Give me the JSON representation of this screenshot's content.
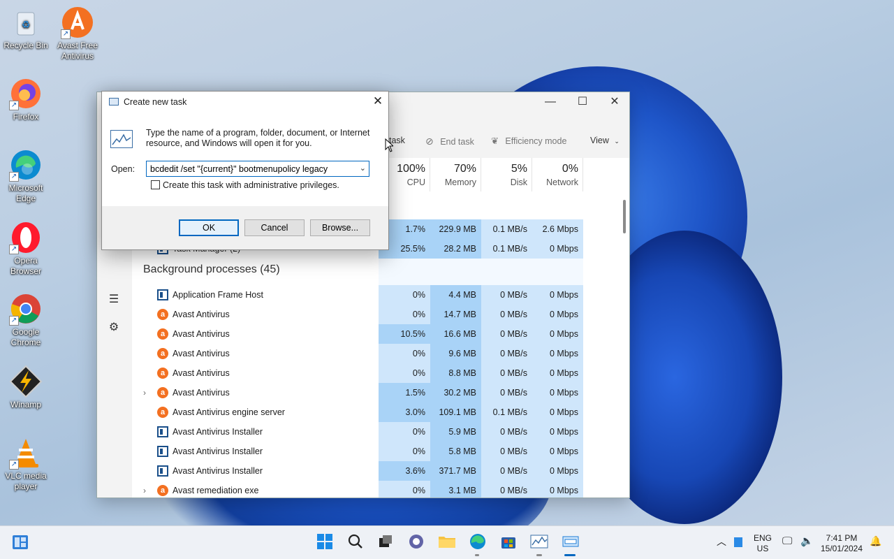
{
  "desktop": {
    "icons": [
      {
        "label": "Recycle Bin",
        "icon": "recycle-bin-icon"
      },
      {
        "label": "Avast Free Antivirus",
        "icon": "avast-icon"
      },
      {
        "label": "Firefox",
        "icon": "firefox-icon"
      },
      {
        "label": "Microsoft Edge",
        "icon": "edge-icon"
      },
      {
        "label": "Opera Browser",
        "icon": "opera-icon"
      },
      {
        "label": "Google Chrome",
        "icon": "chrome-icon"
      },
      {
        "label": "Winamp",
        "icon": "winamp-icon"
      },
      {
        "label": "VLC media player",
        "icon": "vlc-icon"
      }
    ]
  },
  "task_manager": {
    "toolbar": {
      "run_task_fragment": "task",
      "end_task": "End task",
      "efficiency_mode": "Efficiency mode",
      "view": "View"
    },
    "columns": [
      {
        "pct": "100%",
        "name": "CPU"
      },
      {
        "pct": "70%",
        "name": "Memory"
      },
      {
        "pct": "5%",
        "name": "Disk"
      },
      {
        "pct": "0%",
        "name": "Network"
      }
    ],
    "app_rows": [
      {
        "cpu": "1.7%",
        "memory": "229.9 MB",
        "disk": "0.1 MB/s",
        "network": "2.6 Mbps"
      },
      {
        "name": "Task Manager (2)",
        "cpu": "25.5%",
        "memory": "28.2 MB",
        "disk": "0.1 MB/s",
        "network": "0 Mbps"
      }
    ],
    "background_header": "Background processes (45)",
    "background_rows": [
      {
        "name": "Application Frame Host",
        "icon": "app",
        "cpu": "0%",
        "memory": "4.4 MB",
        "disk": "0 MB/s",
        "network": "0 Mbps"
      },
      {
        "name": "Avast Antivirus",
        "icon": "avast",
        "cpu": "0%",
        "memory": "14.7 MB",
        "disk": "0 MB/s",
        "network": "0 Mbps"
      },
      {
        "name": "Avast Antivirus",
        "icon": "avast",
        "cpu": "10.5%",
        "memory": "16.6 MB",
        "disk": "0 MB/s",
        "network": "0 Mbps"
      },
      {
        "name": "Avast Antivirus",
        "icon": "avast",
        "cpu": "0%",
        "memory": "9.6 MB",
        "disk": "0 MB/s",
        "network": "0 Mbps"
      },
      {
        "name": "Avast Antivirus",
        "icon": "avast",
        "cpu": "0%",
        "memory": "8.8 MB",
        "disk": "0 MB/s",
        "network": "0 Mbps"
      },
      {
        "name": "Avast Antivirus",
        "icon": "avast",
        "expandable": true,
        "cpu": "1.5%",
        "memory": "30.2 MB",
        "disk": "0 MB/s",
        "network": "0 Mbps"
      },
      {
        "name": "Avast Antivirus engine server",
        "icon": "avast",
        "cpu": "3.0%",
        "memory": "109.1 MB",
        "disk": "0.1 MB/s",
        "network": "0 Mbps"
      },
      {
        "name": "Avast Antivirus Installer",
        "icon": "app",
        "cpu": "0%",
        "memory": "5.9 MB",
        "disk": "0 MB/s",
        "network": "0 Mbps"
      },
      {
        "name": "Avast Antivirus Installer",
        "icon": "app",
        "cpu": "0%",
        "memory": "5.8 MB",
        "disk": "0 MB/s",
        "network": "0 Mbps"
      },
      {
        "name": "Avast Antivirus Installer",
        "icon": "app",
        "cpu": "3.6%",
        "memory": "371.7 MB",
        "disk": "0 MB/s",
        "network": "0 Mbps"
      },
      {
        "name": "Avast remediation exe",
        "icon": "avast",
        "expandable": true,
        "cpu": "0%",
        "memory": "3.1 MB",
        "disk": "0 MB/s",
        "network": "0 Mbps"
      }
    ]
  },
  "run_dialog": {
    "title": "Create new task",
    "prompt": "Type the name of a program, folder, document, or Internet resource, and Windows will open it for you.",
    "open_label": "Open:",
    "command_value": "bcdedit /set \"{current}\" bootmenupolicy legacy",
    "admin_checkbox_label": "Create this task with administrative privileges.",
    "admin_checked": false,
    "ok": "OK",
    "cancel": "Cancel",
    "browse": "Browse..."
  },
  "taskbar": {
    "lang_line1": "ENG",
    "lang_line2": "US",
    "time": "7:41 PM",
    "date": "15/01/2024"
  },
  "colors": {
    "accent": "#0067c0",
    "heat_low": "#cfe6fb",
    "heat_mid": "#a9d3f7",
    "avast_orange": "#f37021"
  }
}
